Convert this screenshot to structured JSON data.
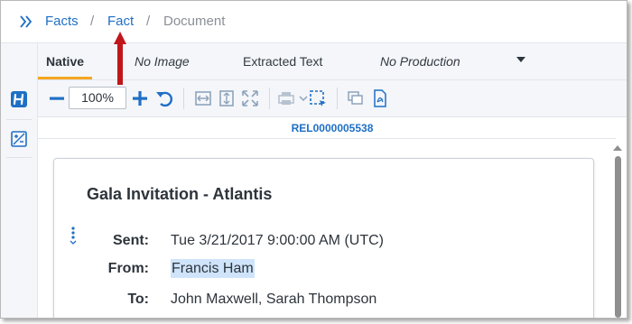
{
  "breadcrumb": {
    "items": [
      "Facts",
      "Fact",
      "Document"
    ],
    "separator": "/"
  },
  "tabs": {
    "items": [
      "Native",
      "No Image",
      "Extracted Text",
      "No Production"
    ],
    "active": "Native"
  },
  "toolbar": {
    "zoom_value": "100%"
  },
  "document": {
    "control_number": "REL0000005538",
    "subject": "Gala Invitation - Atlantis",
    "fields": [
      {
        "label": "Sent:",
        "value": "Tue 3/21/2017 9:00:00 AM (UTC)"
      },
      {
        "label": "From:",
        "value": "Francis Ham"
      },
      {
        "label": "To:",
        "value": "John Maxwell, Sarah Thompson"
      }
    ]
  },
  "colors": {
    "accent": "#1f6fc5",
    "tab_underline": "#f5a623",
    "highlight": "#cfe4fb",
    "annotation_arrow": "#c0161b"
  },
  "icons": {
    "rail": [
      "hyperlink-h-icon",
      "image-edit-icon"
    ],
    "toolbar": [
      "zoom-out-icon",
      "zoom-in-icon",
      "undo-rotate-icon",
      "fit-width-icon",
      "fit-height-icon",
      "fit-screen-icon",
      "print-icon",
      "select-region-icon",
      "layers-icon",
      "pdf-icon"
    ]
  }
}
